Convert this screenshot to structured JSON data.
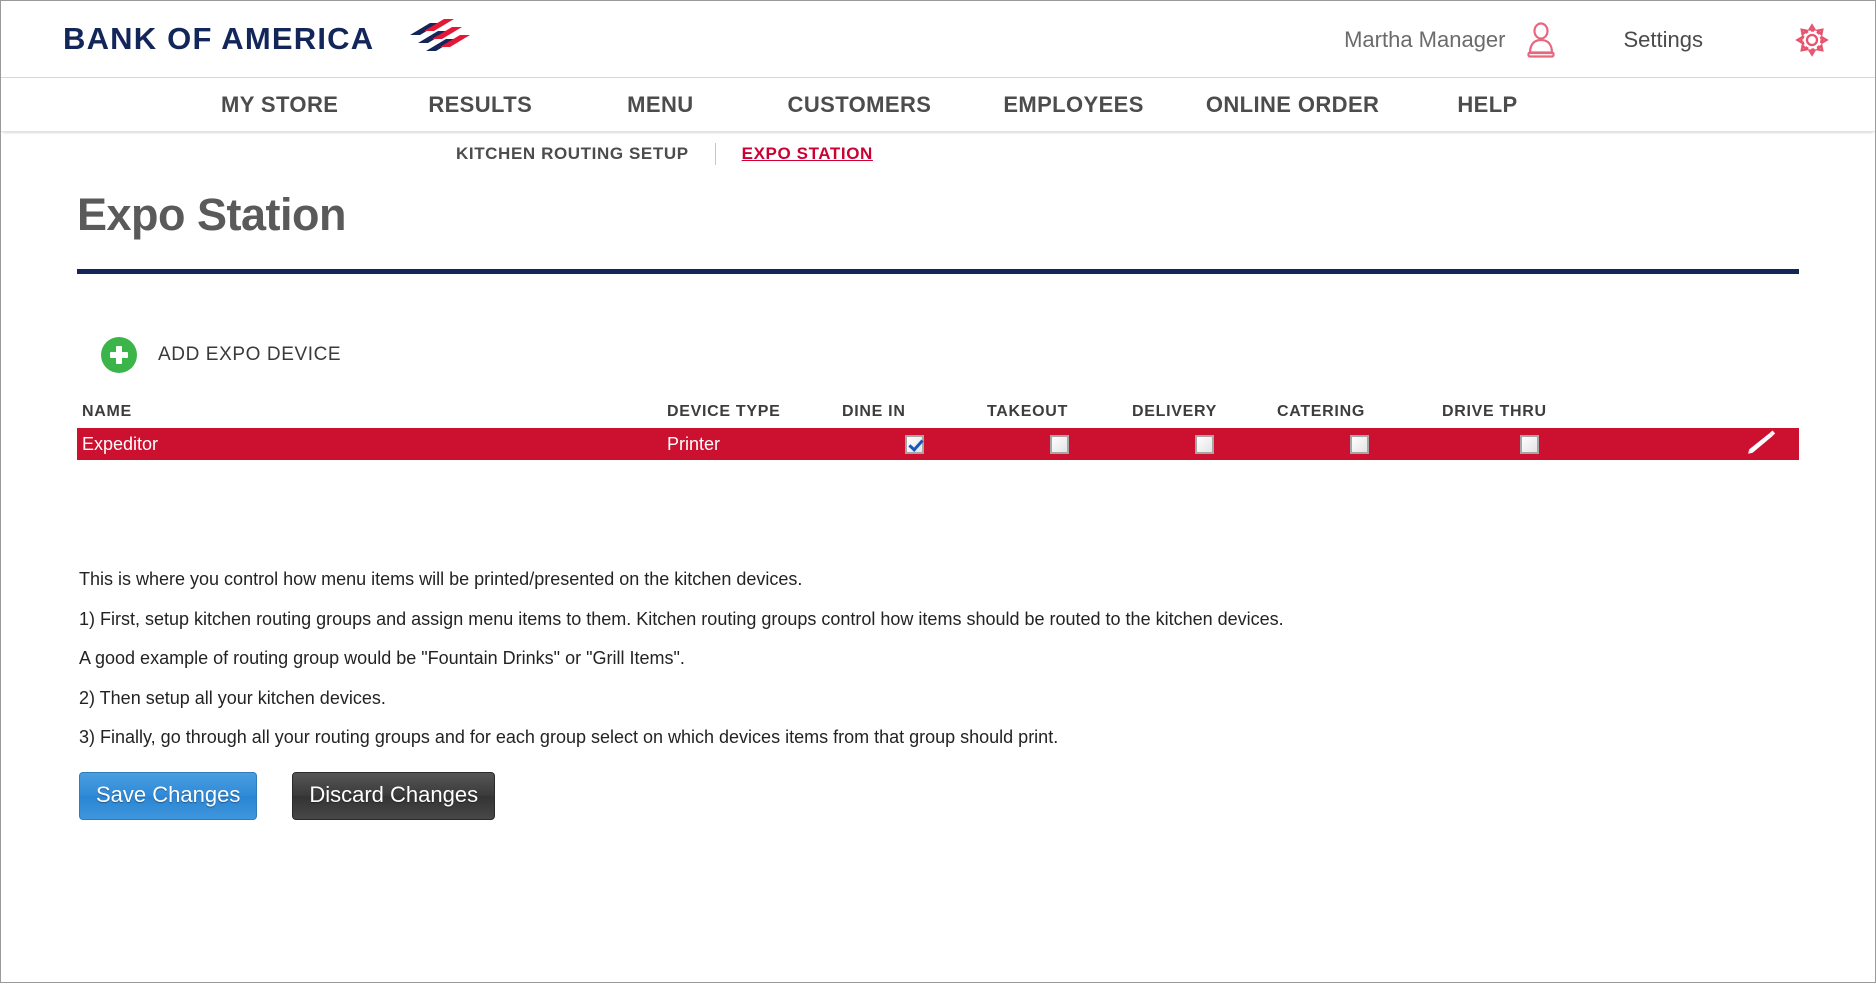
{
  "header": {
    "brand": "BANK OF AMERICA",
    "user_name": "Martha Manager",
    "settings_label": "Settings",
    "person_icon": "person-icon",
    "gear_icon": "gear-icon",
    "brand_navy": "#12265a",
    "brand_red": "#cc0033"
  },
  "nav": {
    "items": [
      {
        "label": "MY STORE"
      },
      {
        "label": "RESULTS"
      },
      {
        "label": "MENU"
      },
      {
        "label": "CUSTOMERS"
      },
      {
        "label": "EMPLOYEES"
      },
      {
        "label": "ONLINE ORDER"
      },
      {
        "label": "HELP"
      }
    ]
  },
  "breadcrumb": {
    "parent": "KITCHEN ROUTING SETUP",
    "current": "EXPO STATION"
  },
  "page": {
    "title": "Expo Station",
    "rule_color": "#12265a"
  },
  "add_device": {
    "label": "ADD EXPO DEVICE",
    "icon": "plus-circle-icon",
    "icon_color": "#3bb44a"
  },
  "table": {
    "columns": [
      "NAME",
      "DEVICE TYPE",
      "DINE IN",
      "TAKEOUT",
      "DELIVERY",
      "CATERING",
      "DRIVE THRU"
    ],
    "row_color": "#cc102f",
    "rows": [
      {
        "name": "Expeditor",
        "device_type": "Printer",
        "dine_in": true,
        "takeout": false,
        "delivery": false,
        "catering": false,
        "drive_thru": false,
        "edit_icon": "pencil-icon"
      }
    ]
  },
  "help": {
    "lines": [
      "This is where you control how menu items will be printed/presented on the kitchen devices.",
      "1) First, setup kitchen routing groups and assign menu items to them. Kitchen routing groups control how items should be routed to the kitchen devices.",
      "A good example of routing group would be \"Fountain Drinks\" or \"Grill Items\".",
      "2) Then setup all your kitchen devices.",
      "3) Finally, go through all your routing groups and for each group select on which devices items from that group should print."
    ]
  },
  "buttons": {
    "save": "Save Changes",
    "discard": "Discard Changes",
    "save_color": "#2f8ad8",
    "discard_color": "#3a3a3a"
  }
}
